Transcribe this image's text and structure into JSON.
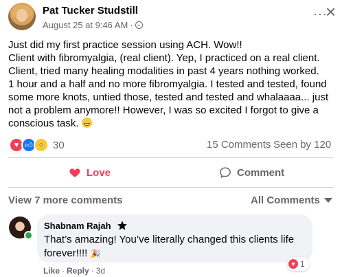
{
  "post": {
    "author": "Pat Tucker Studstill",
    "date": "August 25 at 9:46 AM",
    "separator": "·",
    "more_label": "···",
    "close_label": "×",
    "text_lines": [
      "Just did my first practice session using ACH. Wow!!",
      "Client with fibromyalgia, (real client). Yep, I practiced on a real client.",
      "Client, tried many healing modalities in past 4 years nothing worked.",
      "1 hour and a half and no more fibromyalgia. I tested and tested, found",
      "some more knots, untied those, tested and tested and whalaaaa... just",
      "not a problem anymore!! However, I was so excited I forgot to give a",
      "conscious task."
    ]
  },
  "reactions": {
    "icons": [
      "love-reaction",
      "like-reaction",
      "wow-reaction"
    ],
    "count": "30",
    "comments": "15 Comments",
    "seen_by": "Seen by 120"
  },
  "actions": {
    "love": "Love",
    "comment": "Comment"
  },
  "comments_section": {
    "view_more": "View 7 more comments",
    "filter": "All Comments",
    "comment": {
      "author": "Shabnam Rajah",
      "text_line1": "That’s amazing! You’ve literally changed this clients life",
      "text_line2": "forever!!!! ",
      "reaction_count": "1",
      "like": "Like",
      "reply": "Reply",
      "dot": "·",
      "time": "3d"
    }
  },
  "colors": {
    "love": "#f33e58",
    "like": "#1877f2",
    "muted": "#65676b",
    "bubble": "#f0f2f5",
    "online": "#31a24c"
  }
}
